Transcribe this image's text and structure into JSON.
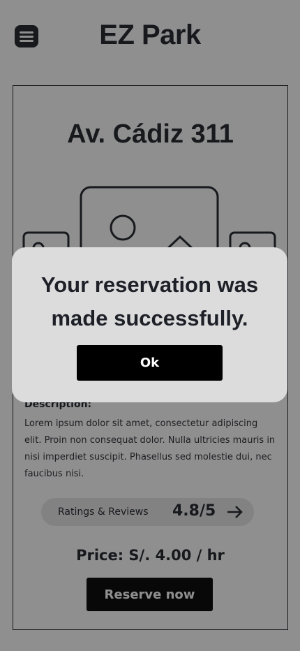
{
  "header": {
    "title": "EZ Park",
    "menu_icon": "hamburger-menu-icon"
  },
  "location": {
    "name": "Av. Cádiz 311",
    "gallery_icons": [
      "image-placeholder-icon",
      "image-placeholder-icon",
      "image-placeholder-icon"
    ]
  },
  "description": {
    "label": "Description:",
    "text": "Lorem ipsum dolor sit amet, consectetur adipiscing elit. Proin non consequat dolor. Nulla ultricies mauris in nisi imperdiet suscipit. Phasellus sed molestie dui, nec faucibus nisi."
  },
  "ratings": {
    "label": "Ratings & Reviews",
    "score": "4.8/5",
    "arrow_icon": "arrow-right-icon"
  },
  "price": "Price: S/. 4.00 / hr",
  "reserve_label": "Reserve now",
  "dialog": {
    "message": "Your reservation was made successfully.",
    "ok_label": "Ok"
  },
  "colors": {
    "primary_text": "#1e2028",
    "button": "#000000",
    "dialog_bg": "#dcdcdc",
    "overlay": "rgba(16,16,16,0.47)"
  }
}
